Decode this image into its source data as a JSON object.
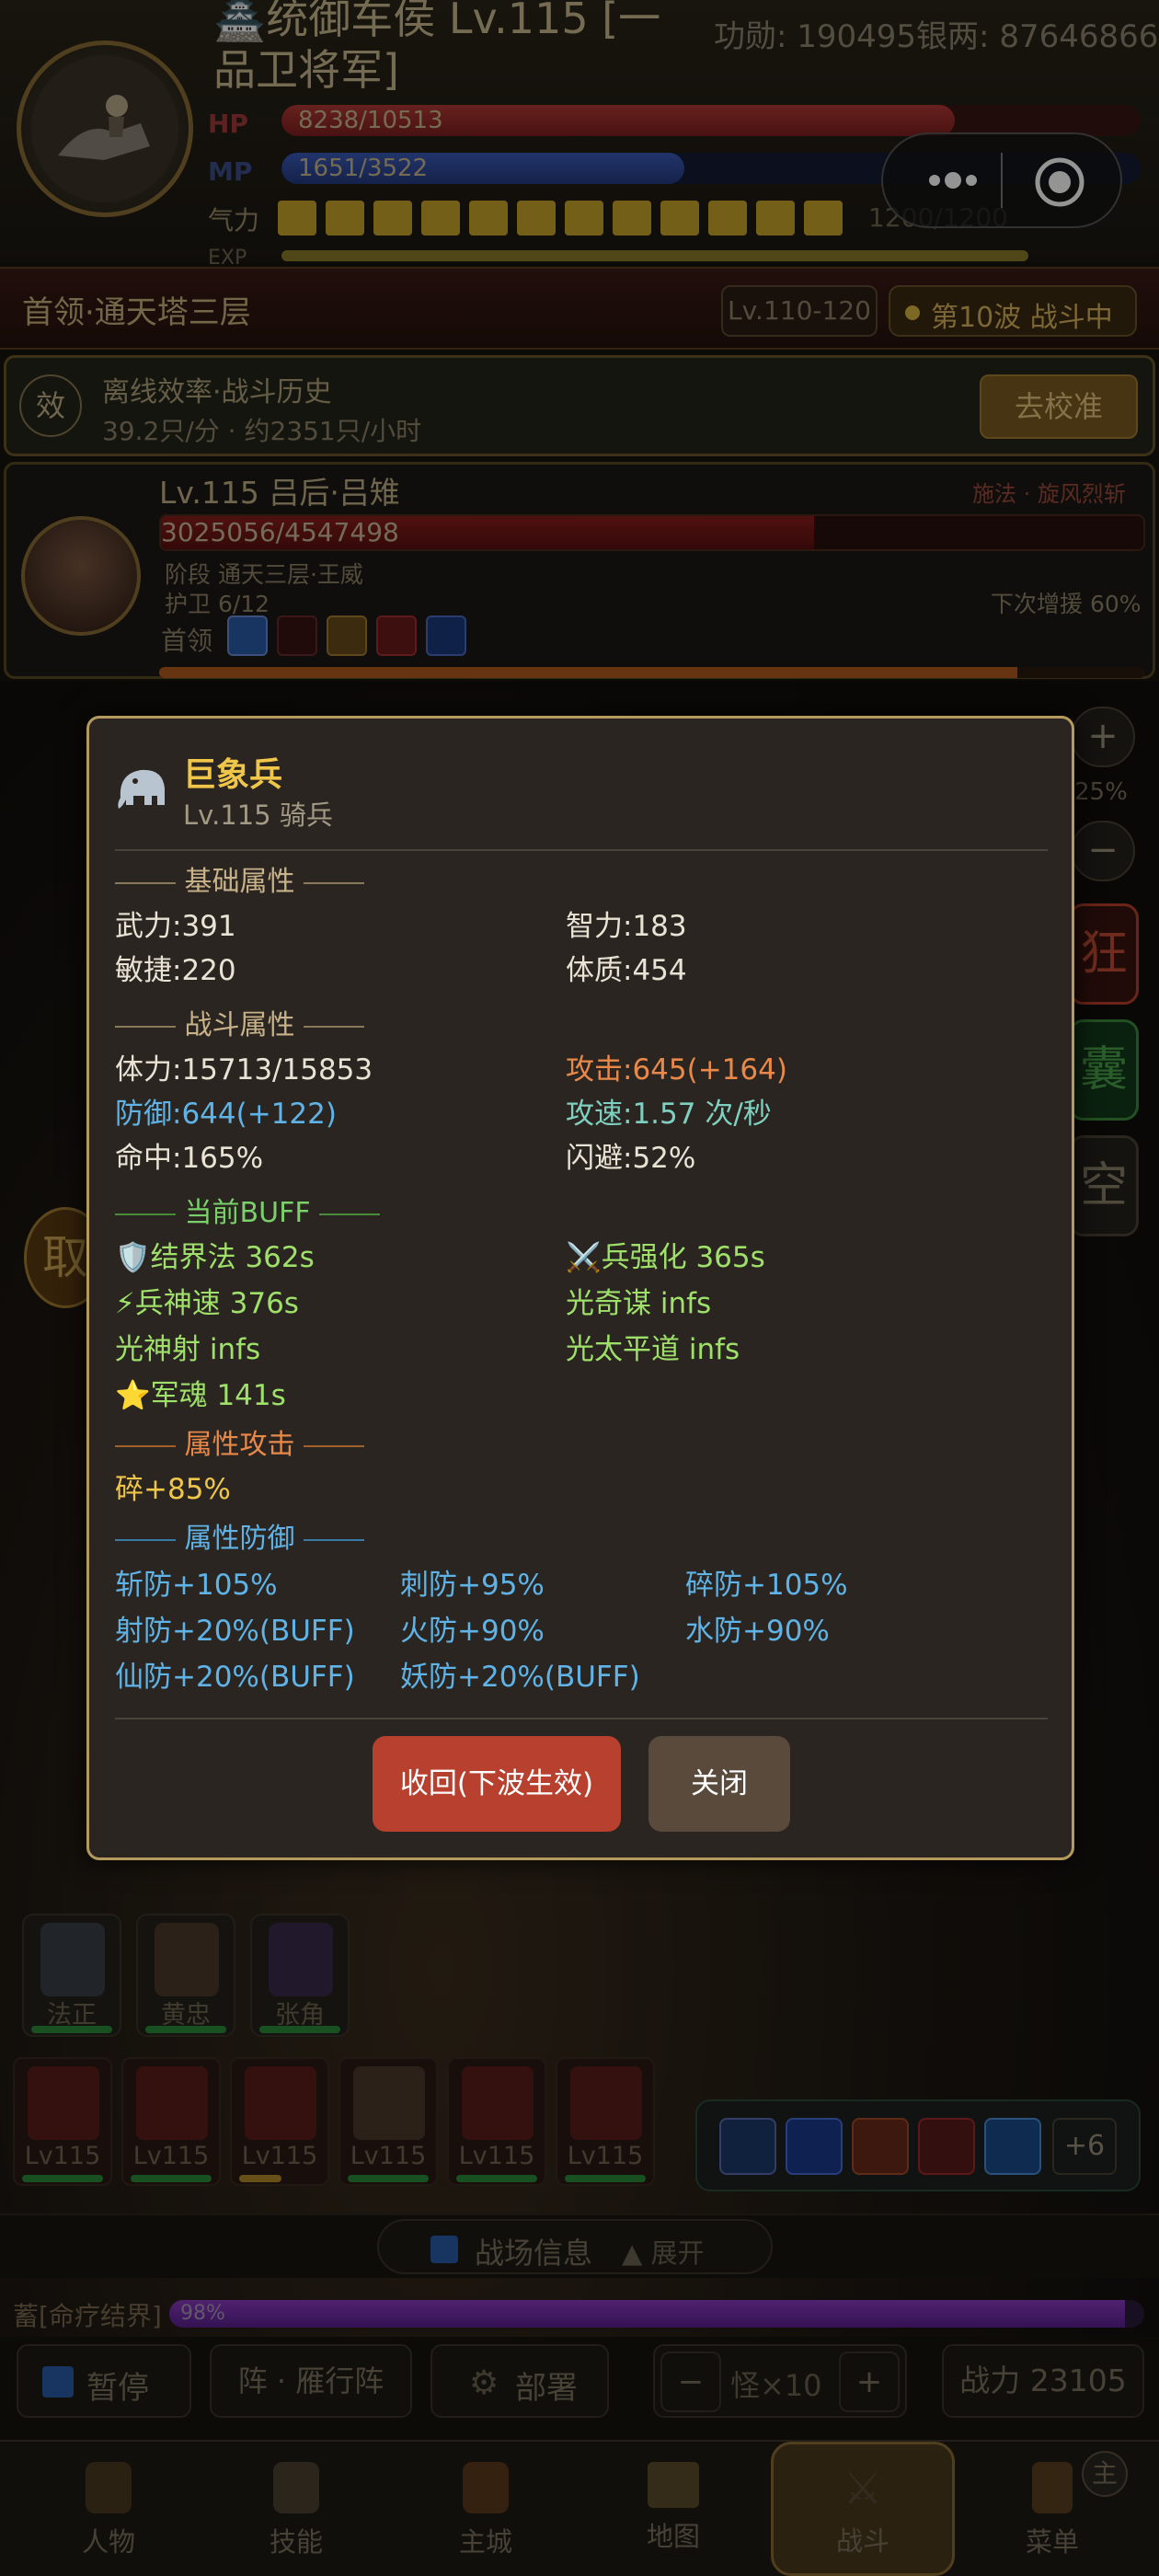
{
  "header": {
    "title": "🏯统御车侯 Lv.115 [一品卫将军]",
    "merit": "功勋: 190495银两: 87646866",
    "hp_label": "HP",
    "hp_value": "8238/10513",
    "hp_ratio": 0.7836,
    "mp_label": "MP",
    "mp_value": "1651/3522",
    "mp_ratio": 0.4688,
    "qi_label": "气力",
    "qi_value": "1200/1200",
    "exp_label": "EXP"
  },
  "capsule": {
    "more_icon": "more-dots-icon",
    "target_icon": "target-icon"
  },
  "stage": {
    "name": "首领·通天塔三层",
    "level_range": "Lv.110-120",
    "wave": "第10波 战斗中"
  },
  "efficiency": {
    "badge": "效",
    "title": "离线效率·战斗历史",
    "detail": "39.2只/分 · 约2351只/小时",
    "calibrate_button": "去校准"
  },
  "boss": {
    "name": "Lv.115 吕后·吕雉",
    "skill": "施法 · 旋风烈斩",
    "hp_value": "3025056/4547498",
    "hp_ratio": 0.6652,
    "stage_text": "阶段  通天三层·王威",
    "guards": "护卫 6/12",
    "next_boost": "下次增援 60%",
    "tag": "首领",
    "rage_ratio": 0.87
  },
  "side_controls": {
    "zoom_in": "+",
    "zoom_pct": "25%",
    "zoom_out": "−",
    "btn1": "狂",
    "btn2": "囊",
    "btn3": "空",
    "left_btn": "取"
  },
  "modal": {
    "unit_icon": "elephant-icon",
    "unit_name": "巨象兵",
    "unit_sub": "Lv.115 骑兵",
    "basic_header": "基础属性",
    "basic": [
      "武力:391",
      "智力:183",
      "敏捷:220",
      "体质:454"
    ],
    "battle_header": "战斗属性",
    "battle": {
      "stamina": "体力:15713/15853",
      "attack": "攻击:645(+164)",
      "defense": "防御:644(+122)",
      "speed": "攻速:1.57 次/秒",
      "hit": "命中:165%",
      "dodge": "闪避:52%"
    },
    "buff_header": "当前BUFF",
    "buffs": [
      "🛡️结界法 362s",
      "⚔️兵强化 365s",
      "⚡兵神速 376s",
      "光奇谋 infs",
      "光神射 infs",
      "光太平道 infs",
      "⭐军魂 141s"
    ],
    "atk_header": "属性攻击",
    "atk": "碎+85%",
    "def_header": "属性防御",
    "defs": [
      "斩防+105%",
      "刺防+95%",
      "碎防+105%",
      "射防+20%(BUFF)",
      "火防+90%",
      "水防+90%",
      "仙防+20%(BUFF)",
      "妖防+20%(BUFF)"
    ],
    "recall_button": "收回(下波生效)",
    "close_button": "关闭"
  },
  "heroes": [
    "法正",
    "黄忠",
    "张角"
  ],
  "units": [
    "Lv115",
    "Lv115",
    "Lv115",
    "Lv115",
    "Lv115",
    "Lv115"
  ],
  "skills_more": "+6",
  "battle_info": {
    "label": "战场信息",
    "toggle": "▲ 展开"
  },
  "buff_bar": {
    "label": "蓄[命疗结界]",
    "value": "98%",
    "ratio": 0.98
  },
  "controls": {
    "pause": "暂停",
    "formation": "阵 · 雁行阵",
    "deploy": "部署",
    "minus": "−",
    "monsters": "怪×10",
    "plus": "+",
    "power": "战力 23105"
  },
  "nav": [
    "人物",
    "技能",
    "主城",
    "地图",
    "战斗",
    "菜单"
  ],
  "nav_badge": "主",
  "colors": {
    "gold": "#f0c64a",
    "orange": "#e8894a",
    "blue": "#5fb3e6",
    "green": "#9ee06a",
    "red_btn": "#b7402e"
  }
}
